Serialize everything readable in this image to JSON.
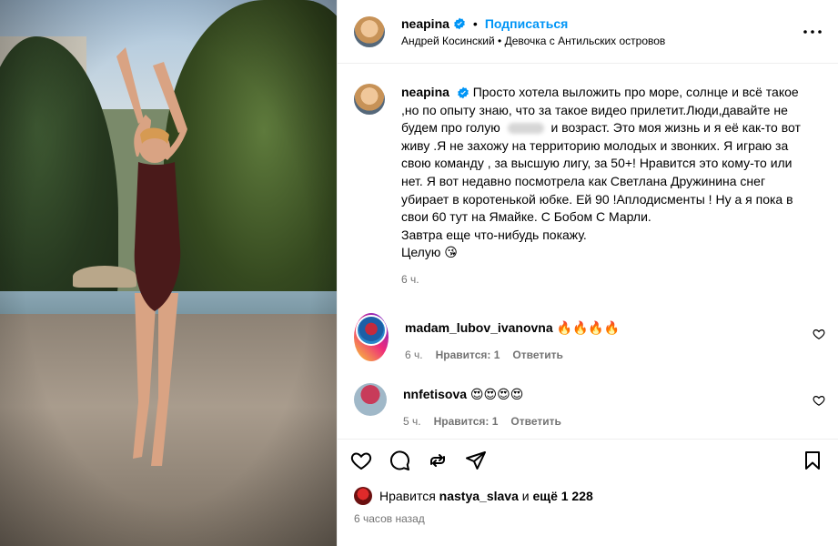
{
  "post": {
    "username": "neapina",
    "follow_label": "Подписаться",
    "dot": "•",
    "audio_artist": "Андрей Косинский",
    "audio_track": "Девочка с Антильских островов",
    "caption_before_blur": "Просто хотела выложить про море, солнце и всё такое ,но по опыту знаю, что за такое видео прилетит.Люди,давайте не будем про голую",
    "caption_after_blur": "и возраст. Это моя жизнь и я её как-то вот живу .Я не захожу на территорию молодых и звонких. Я играю за свою команду , за высшую лигу, за 50+! Нравится это кому-то или нет. Я вот недавно посмотрела как Светлана Дружинина снег убирает в коротенькой юбке. Ей 90 !Аплодисменты ! Ну а я пока в свои 60 тут на Ямайке. С Бобом С Марли.",
    "caption_line2": "Завтра еще что-нибудь покажу.",
    "caption_line3": "Целую 😘",
    "caption_age": "6 ч."
  },
  "comments": [
    {
      "username": "madam_lubov_ivanovna",
      "text": "🔥🔥🔥🔥",
      "age": "6 ч.",
      "likes": "Нравится: 1",
      "reply": "Ответить"
    },
    {
      "username": "nnfetisova",
      "text": "😍😍😍😍",
      "age": "5 ч.",
      "likes": "Нравится: 1",
      "reply": "Ответить"
    }
  ],
  "likes_bar": {
    "prefix": "Нравится",
    "user": "nastya_slava",
    "connector": "и",
    "rest": "ещё 1 228"
  },
  "timestamp": "6 часов назад",
  "icons": [
    "verified-badge-icon",
    "more-options-icon",
    "heart-icon",
    "comment-icon",
    "repost-icon",
    "share-icon",
    "bookmark-icon"
  ],
  "colors": {
    "accent": "#0095f6",
    "secondary_text": "#737373"
  }
}
